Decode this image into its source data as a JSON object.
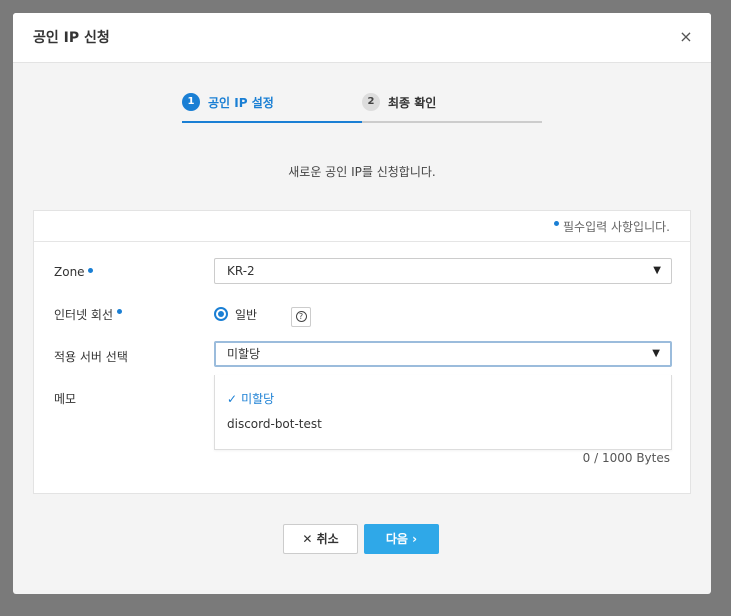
{
  "modal": {
    "title": "공인 IP 신청",
    "close_icon": "×"
  },
  "steps": [
    {
      "num": "1",
      "label": "공인 IP 설정",
      "active": true
    },
    {
      "num": "2",
      "label": "최종 확인",
      "active": false
    }
  ],
  "intro": "새로운 공인 IP를 신청합니다.",
  "required_note": "필수입력 사항입니다.",
  "form": {
    "zone": {
      "label": "Zone",
      "value": "KR-2",
      "caret": "▼"
    },
    "internet_line": {
      "label": "인터넷 회선",
      "option": "일반",
      "help_icon": "?"
    },
    "server_select": {
      "label": "적용 서버 선택",
      "value": "미할당",
      "caret": "▼"
    },
    "memo": {
      "label": "메모"
    },
    "dropdown_options": [
      {
        "label": "미할당",
        "selected": true,
        "check_icon": "✓"
      },
      {
        "label": "discord-bot-test",
        "selected": false
      }
    ],
    "bytes_counter": "0 / 1000 Bytes"
  },
  "buttons": {
    "cancel": {
      "icon": "✕",
      "label": "취소"
    },
    "next": {
      "label": "다음",
      "icon": "›"
    }
  },
  "colors": {
    "accent": "#1a7fd4",
    "next_button": "#2fa8e8",
    "overlay": "#7a7a7a"
  }
}
